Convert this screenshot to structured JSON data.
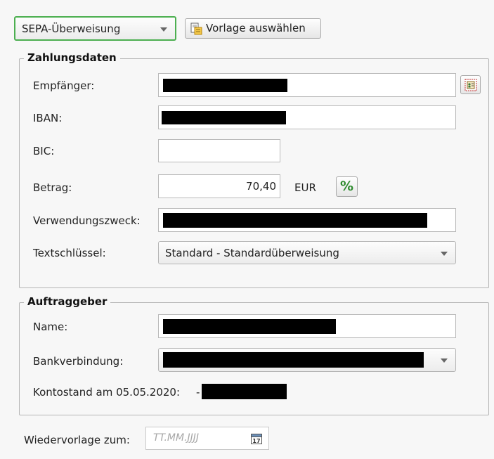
{
  "top": {
    "type_select": "SEPA-Überweisung",
    "template_button": "Vorlage auswählen"
  },
  "payment": {
    "legend": "Zahlungsdaten",
    "recipient_label": "Empfänger:",
    "iban_label": "IBAN:",
    "bic_label": "BIC:",
    "amount_label": "Betrag:",
    "amount_value": "70,40",
    "currency": "EUR",
    "percent_symbol": "%",
    "purpose_label": "Verwendungszweck:",
    "textkey_label": "Textschlüssel:",
    "textkey_value": "Standard - Standardüberweisung"
  },
  "orderer": {
    "legend": "Auftraggeber",
    "name_label": "Name:",
    "bank_label": "Bankverbindung:",
    "balance_label": "Kontostand am 05.05.2020:",
    "balance_sign": "-"
  },
  "resubmission": {
    "label": "Wiedervorlage zum:",
    "placeholder": "TT.MM.JJJJ"
  },
  "colors": {
    "focus_border": "#4caf50",
    "percent_green": "#2e8b2e",
    "redaction": "#000000"
  },
  "icons": {
    "template": "document-template-icon",
    "address_book": "address-book-icon",
    "calendar": "calendar-icon",
    "dropdown": "chevron-down-icon"
  }
}
